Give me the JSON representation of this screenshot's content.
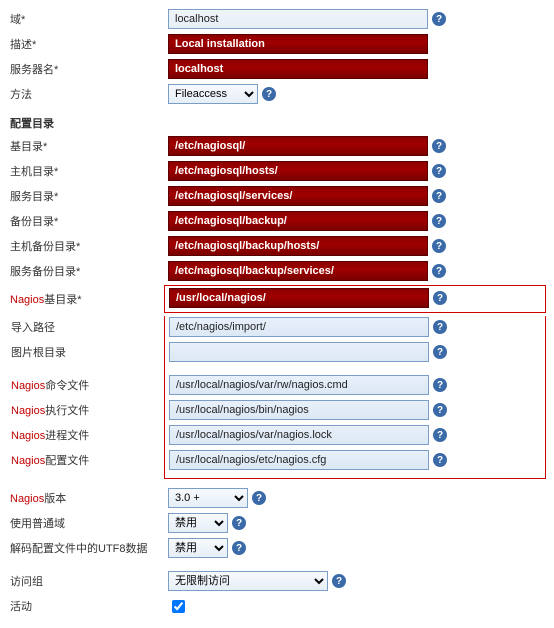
{
  "top": {
    "domain_label": "域*",
    "domain_value": "localhost",
    "desc_label": "描述*",
    "desc_value": "Local installation",
    "server_label": "服务器名*",
    "server_value": "localhost",
    "method_label": "方法",
    "method_value": "Fileaccess"
  },
  "section1_title": "配置目录",
  "dirs": {
    "base_label": "基目录*",
    "base_value": "/etc/nagiosql/",
    "host_label": "主机目录*",
    "host_value": "/etc/nagiosql/hosts/",
    "service_label": "服务目录*",
    "service_value": "/etc/nagiosql/services/",
    "backup_label": "备份目录*",
    "backup_value": "/etc/nagiosql/backup/",
    "host_backup_label": "主机备份目录*",
    "host_backup_value": "/etc/nagiosql/backup/hosts/",
    "service_backup_label": "服务备份目录*",
    "service_backup_value": "/etc/nagiosql/backup/services/"
  },
  "nagios_box": {
    "base_label_prefix": "Nagios",
    "base_label_rest": "基目录*",
    "base_value": "/usr/local/nagios/",
    "import_label": "导入路径",
    "import_value": "/etc/nagios/import/",
    "pic_label": "图片根目录",
    "pic_value": "",
    "cmd_label_prefix": "Nagios",
    "cmd_label_rest": "命令文件",
    "cmd_value": "/usr/local/nagios/var/rw/nagios.cmd",
    "exec_label_prefix": "Nagios",
    "exec_label_rest": "执行文件",
    "exec_value": "/usr/local/nagios/bin/nagios",
    "proc_label_prefix": "Nagios",
    "proc_label_rest": "进程文件",
    "proc_value": "/usr/local/nagios/var/nagios.lock",
    "cfg_label_prefix": "Nagios",
    "cfg_label_rest": "配置文件",
    "cfg_value": "/usr/local/nagios/etc/nagios.cfg"
  },
  "bottom": {
    "version_label_prefix": "Nagios",
    "version_label_rest": "版本",
    "version_value": "3.0 +",
    "common_domain_label": "使用普通域",
    "common_domain_value": "禁用",
    "utf8_label": "解码配置文件中的UTF8数据",
    "utf8_value": "禁用",
    "access_label": "访问组",
    "access_value": "无限制访问",
    "active_label": "活动"
  },
  "help_glyph": "?"
}
